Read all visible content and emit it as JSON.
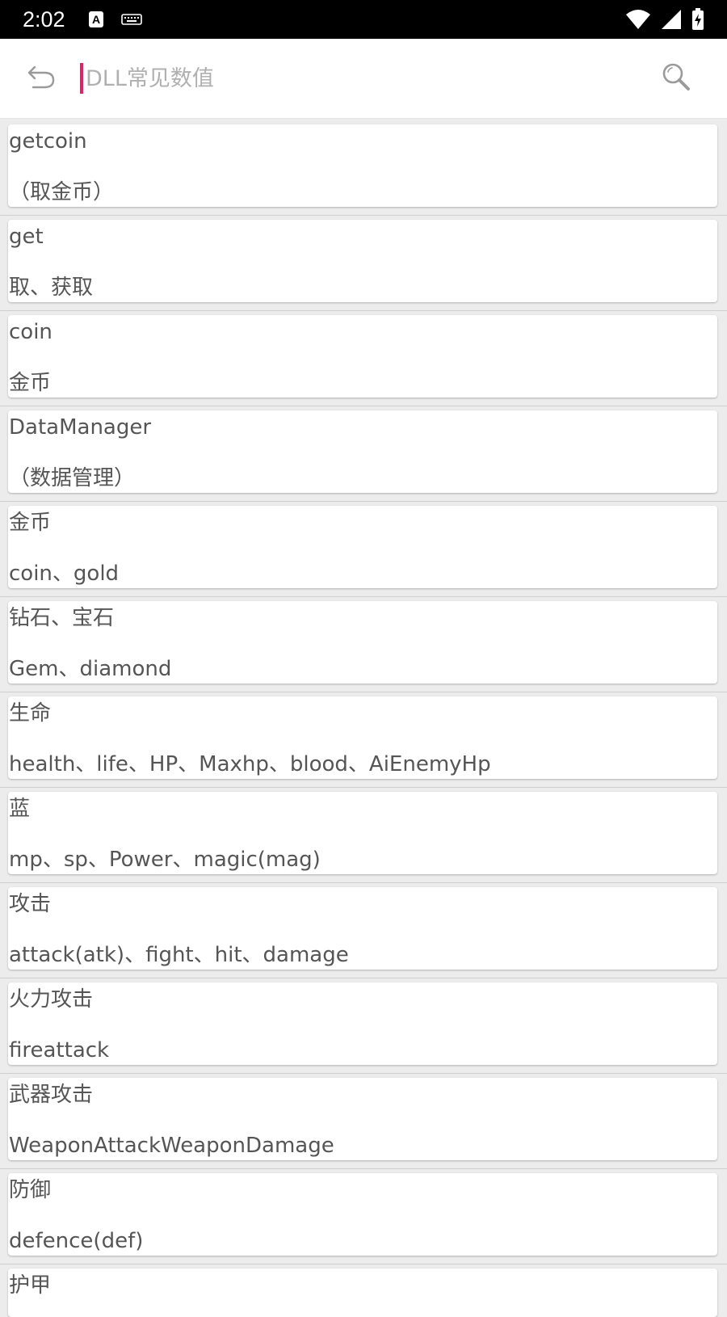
{
  "status_bar": {
    "time": "2:02",
    "notification_icon_letter": "A",
    "icons": [
      "a-notification-icon",
      "keyboard-icon",
      "wifi-icon",
      "cell-signal-icon",
      "battery-charging-icon"
    ]
  },
  "app_bar": {
    "back_icon": "undo-arrow-icon",
    "search_placeholder": "DLL常见数值",
    "search_value": "",
    "search_icon": "magnifier-icon",
    "accent_color": "#e91e63"
  },
  "list": {
    "items": [
      {
        "title": "getcoin",
        "desc": "（取金币）"
      },
      {
        "title": "get",
        "desc": "取、获取"
      },
      {
        "title": "coin",
        "desc": "金币"
      },
      {
        "title": "DataManager",
        "desc": "（数据管理）"
      },
      {
        "title": "金币",
        "desc": "coin、gold"
      },
      {
        "title": "钻石、宝石",
        "desc": "Gem、diamond"
      },
      {
        "title": "生命",
        "desc": "health、life、HP、Maxhp、blood、AiEnemyHp"
      },
      {
        "title": "蓝",
        "desc": "mp、sp、Power、magic(mag)"
      },
      {
        "title": "攻击",
        "desc": "attack(atk)、fight、hit、damage"
      },
      {
        "title": "火力攻击",
        "desc": "fireattack"
      },
      {
        "title": "武器攻击",
        "desc": "WeaponAttackWeaponDamage"
      },
      {
        "title": "防御",
        "desc": "defence(def)"
      },
      {
        "title": "护甲",
        "desc": ""
      }
    ]
  },
  "colors": {
    "status_bar_bg": "#000000",
    "app_bar_bg": "#ffffff",
    "list_bg": "#ececec",
    "card_bg": "#ffffff",
    "text": "#555555"
  }
}
